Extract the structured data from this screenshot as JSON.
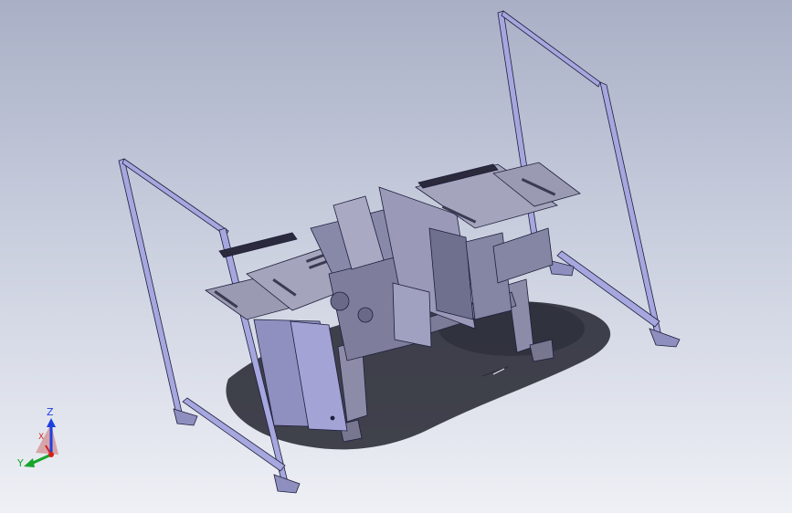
{
  "viewport": {
    "background_top": "#a9b0c6",
    "background_bottom": "#eef0f5",
    "model_description_visible": false
  },
  "model_colors": {
    "frame": "#a7a7df",
    "frame_edge": "#1e1e3c",
    "plate": "#9a9ab2",
    "plate_dark": "#77778f",
    "machine": "#8c8ca8",
    "shadow": "#22232e"
  },
  "triad": {
    "z_label": "Z",
    "x_label": "X",
    "y_label": "Y",
    "z_color": "#1f3fe0",
    "x_color": "#d21f1f",
    "y_color": "#17a52b"
  }
}
